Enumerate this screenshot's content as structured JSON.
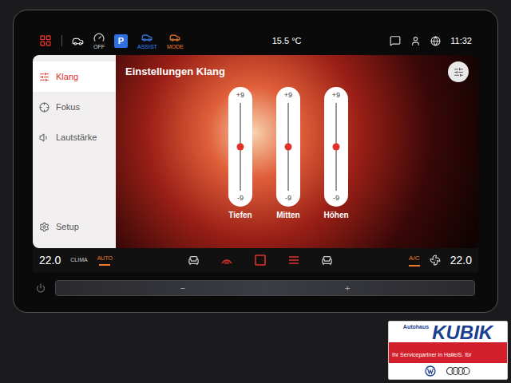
{
  "status_bar": {
    "items": [
      {
        "label": "OFF",
        "kind": "gauge",
        "color": "#d9d9d9"
      },
      {
        "label": "P",
        "kind": "park",
        "color": "#2f6fe0"
      },
      {
        "label": "ASSIST",
        "kind": "assist",
        "color": "#3b82f6"
      },
      {
        "label": "MODE",
        "kind": "mode",
        "color": "#f07a2a"
      }
    ],
    "temperature": "15.5 °C",
    "time": "11:32"
  },
  "sidebar": {
    "items": [
      {
        "label": "Klang",
        "selected": true
      },
      {
        "label": "Fokus",
        "selected": false
      },
      {
        "label": "Lautstärke",
        "selected": false
      },
      {
        "label": "Setup",
        "selected": false
      }
    ]
  },
  "title": "Einstellungen Klang",
  "equalizer": {
    "bands": [
      {
        "name": "Tiefen",
        "max": "+9",
        "min": "-9",
        "level": 0.5
      },
      {
        "name": "Mitten",
        "max": "+9",
        "min": "-9",
        "level": 0.5
      },
      {
        "name": "Höhen",
        "max": "+9",
        "min": "-9",
        "level": 0.5
      }
    ]
  },
  "climate": {
    "left_temp": "22.0",
    "right_temp": "22.0",
    "left_buttons": [
      {
        "label": "CLIMA",
        "active": false
      },
      {
        "label": "AUTO",
        "active": true
      }
    ],
    "controls": [
      {
        "kind": "seat",
        "active": false
      },
      {
        "kind": "windshield",
        "active": true
      },
      {
        "kind": "max",
        "active": true
      },
      {
        "kind": "rear",
        "active": true
      },
      {
        "kind": "seat-vent",
        "active": false
      }
    ],
    "right_buttons": [
      {
        "label": "A/C",
        "active": true
      }
    ]
  },
  "volume_slider": {
    "minus": "−",
    "plus": "+"
  },
  "dealer_logo": {
    "top": "Autohaus",
    "name": "KUBIK",
    "tagline": "Ihr Servicepartner in Halle/S. für"
  }
}
